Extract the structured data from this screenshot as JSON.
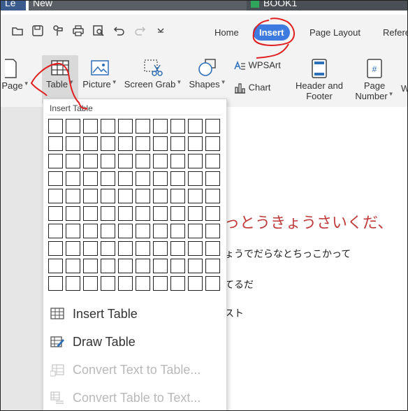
{
  "tabs": {
    "tab1": "Le",
    "tab2": "New",
    "tab3": "BOOK1"
  },
  "toolbar_icons": [
    "open-folder-icon",
    "save-icon",
    "format-painter-icon",
    "print-icon",
    "print-preview-icon",
    "undo-icon",
    "redo-icon",
    "more-dropdown-icon"
  ],
  "nav": {
    "home": "Home",
    "insert": "Insert",
    "page_layout": "Page Layout",
    "references": "Refere"
  },
  "ribbon": {
    "page": "Page",
    "table": "Table",
    "picture": "Picture",
    "screen_grab": "Screen Grab",
    "shapes": "Shapes",
    "wpsart": "WPSArt",
    "chart": "Chart",
    "header_footer_1": "Header and",
    "header_footer_2": "Footer",
    "page_number_1": "Page",
    "page_number_2": "Number",
    "cut_off": "W"
  },
  "dropdown": {
    "title": "Insert Table",
    "grid_cols": 10,
    "grid_rows": 10,
    "items": [
      {
        "label": "Insert Table",
        "disabled": false
      },
      {
        "label": "Draw Table",
        "disabled": false
      },
      {
        "label": "Convert Text to Table...",
        "disabled": true
      },
      {
        "label": "Convert Table to Text...",
        "disabled": true
      }
    ]
  },
  "document": {
    "line1": "っとうきょうさいくだ、",
    "line2": "ょうでだらなとちっこかって",
    "line3": "てるだ",
    "line4": "スト"
  },
  "colors": {
    "accent": "#3d7be0",
    "annotation": "#e02020",
    "heading_red": "#c03b3b"
  }
}
